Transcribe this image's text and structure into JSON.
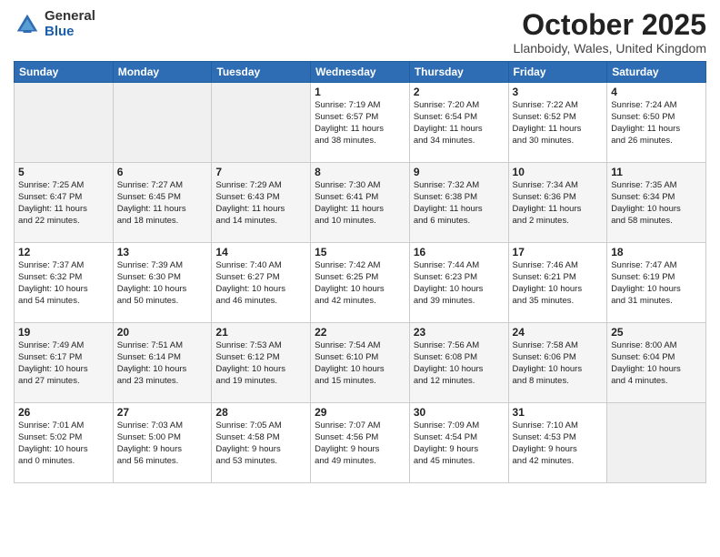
{
  "logo": {
    "general": "General",
    "blue": "Blue"
  },
  "title": "October 2025",
  "location": "Llanboidy, Wales, United Kingdom",
  "weekdays": [
    "Sunday",
    "Monday",
    "Tuesday",
    "Wednesday",
    "Thursday",
    "Friday",
    "Saturday"
  ],
  "weeks": [
    [
      {
        "day": "",
        "empty": true
      },
      {
        "day": "",
        "empty": true
      },
      {
        "day": "",
        "empty": true
      },
      {
        "day": "1",
        "line1": "Sunrise: 7:19 AM",
        "line2": "Sunset: 6:57 PM",
        "line3": "Daylight: 11 hours",
        "line4": "and 38 minutes."
      },
      {
        "day": "2",
        "line1": "Sunrise: 7:20 AM",
        "line2": "Sunset: 6:54 PM",
        "line3": "Daylight: 11 hours",
        "line4": "and 34 minutes."
      },
      {
        "day": "3",
        "line1": "Sunrise: 7:22 AM",
        "line2": "Sunset: 6:52 PM",
        "line3": "Daylight: 11 hours",
        "line4": "and 30 minutes."
      },
      {
        "day": "4",
        "line1": "Sunrise: 7:24 AM",
        "line2": "Sunset: 6:50 PM",
        "line3": "Daylight: 11 hours",
        "line4": "and 26 minutes."
      }
    ],
    [
      {
        "day": "5",
        "line1": "Sunrise: 7:25 AM",
        "line2": "Sunset: 6:47 PM",
        "line3": "Daylight: 11 hours",
        "line4": "and 22 minutes."
      },
      {
        "day": "6",
        "line1": "Sunrise: 7:27 AM",
        "line2": "Sunset: 6:45 PM",
        "line3": "Daylight: 11 hours",
        "line4": "and 18 minutes."
      },
      {
        "day": "7",
        "line1": "Sunrise: 7:29 AM",
        "line2": "Sunset: 6:43 PM",
        "line3": "Daylight: 11 hours",
        "line4": "and 14 minutes."
      },
      {
        "day": "8",
        "line1": "Sunrise: 7:30 AM",
        "line2": "Sunset: 6:41 PM",
        "line3": "Daylight: 11 hours",
        "line4": "and 10 minutes."
      },
      {
        "day": "9",
        "line1": "Sunrise: 7:32 AM",
        "line2": "Sunset: 6:38 PM",
        "line3": "Daylight: 11 hours",
        "line4": "and 6 minutes."
      },
      {
        "day": "10",
        "line1": "Sunrise: 7:34 AM",
        "line2": "Sunset: 6:36 PM",
        "line3": "Daylight: 11 hours",
        "line4": "and 2 minutes."
      },
      {
        "day": "11",
        "line1": "Sunrise: 7:35 AM",
        "line2": "Sunset: 6:34 PM",
        "line3": "Daylight: 10 hours",
        "line4": "and 58 minutes."
      }
    ],
    [
      {
        "day": "12",
        "line1": "Sunrise: 7:37 AM",
        "line2": "Sunset: 6:32 PM",
        "line3": "Daylight: 10 hours",
        "line4": "and 54 minutes."
      },
      {
        "day": "13",
        "line1": "Sunrise: 7:39 AM",
        "line2": "Sunset: 6:30 PM",
        "line3": "Daylight: 10 hours",
        "line4": "and 50 minutes."
      },
      {
        "day": "14",
        "line1": "Sunrise: 7:40 AM",
        "line2": "Sunset: 6:27 PM",
        "line3": "Daylight: 10 hours",
        "line4": "and 46 minutes."
      },
      {
        "day": "15",
        "line1": "Sunrise: 7:42 AM",
        "line2": "Sunset: 6:25 PM",
        "line3": "Daylight: 10 hours",
        "line4": "and 42 minutes."
      },
      {
        "day": "16",
        "line1": "Sunrise: 7:44 AM",
        "line2": "Sunset: 6:23 PM",
        "line3": "Daylight: 10 hours",
        "line4": "and 39 minutes."
      },
      {
        "day": "17",
        "line1": "Sunrise: 7:46 AM",
        "line2": "Sunset: 6:21 PM",
        "line3": "Daylight: 10 hours",
        "line4": "and 35 minutes."
      },
      {
        "day": "18",
        "line1": "Sunrise: 7:47 AM",
        "line2": "Sunset: 6:19 PM",
        "line3": "Daylight: 10 hours",
        "line4": "and 31 minutes."
      }
    ],
    [
      {
        "day": "19",
        "line1": "Sunrise: 7:49 AM",
        "line2": "Sunset: 6:17 PM",
        "line3": "Daylight: 10 hours",
        "line4": "and 27 minutes."
      },
      {
        "day": "20",
        "line1": "Sunrise: 7:51 AM",
        "line2": "Sunset: 6:14 PM",
        "line3": "Daylight: 10 hours",
        "line4": "and 23 minutes."
      },
      {
        "day": "21",
        "line1": "Sunrise: 7:53 AM",
        "line2": "Sunset: 6:12 PM",
        "line3": "Daylight: 10 hours",
        "line4": "and 19 minutes."
      },
      {
        "day": "22",
        "line1": "Sunrise: 7:54 AM",
        "line2": "Sunset: 6:10 PM",
        "line3": "Daylight: 10 hours",
        "line4": "and 15 minutes."
      },
      {
        "day": "23",
        "line1": "Sunrise: 7:56 AM",
        "line2": "Sunset: 6:08 PM",
        "line3": "Daylight: 10 hours",
        "line4": "and 12 minutes."
      },
      {
        "day": "24",
        "line1": "Sunrise: 7:58 AM",
        "line2": "Sunset: 6:06 PM",
        "line3": "Daylight: 10 hours",
        "line4": "and 8 minutes."
      },
      {
        "day": "25",
        "line1": "Sunrise: 8:00 AM",
        "line2": "Sunset: 6:04 PM",
        "line3": "Daylight: 10 hours",
        "line4": "and 4 minutes."
      }
    ],
    [
      {
        "day": "26",
        "line1": "Sunrise: 7:01 AM",
        "line2": "Sunset: 5:02 PM",
        "line3": "Daylight: 10 hours",
        "line4": "and 0 minutes."
      },
      {
        "day": "27",
        "line1": "Sunrise: 7:03 AM",
        "line2": "Sunset: 5:00 PM",
        "line3": "Daylight: 9 hours",
        "line4": "and 56 minutes."
      },
      {
        "day": "28",
        "line1": "Sunrise: 7:05 AM",
        "line2": "Sunset: 4:58 PM",
        "line3": "Daylight: 9 hours",
        "line4": "and 53 minutes."
      },
      {
        "day": "29",
        "line1": "Sunrise: 7:07 AM",
        "line2": "Sunset: 4:56 PM",
        "line3": "Daylight: 9 hours",
        "line4": "and 49 minutes."
      },
      {
        "day": "30",
        "line1": "Sunrise: 7:09 AM",
        "line2": "Sunset: 4:54 PM",
        "line3": "Daylight: 9 hours",
        "line4": "and 45 minutes."
      },
      {
        "day": "31",
        "line1": "Sunrise: 7:10 AM",
        "line2": "Sunset: 4:53 PM",
        "line3": "Daylight: 9 hours",
        "line4": "and 42 minutes."
      },
      {
        "day": "",
        "empty": true
      }
    ]
  ]
}
